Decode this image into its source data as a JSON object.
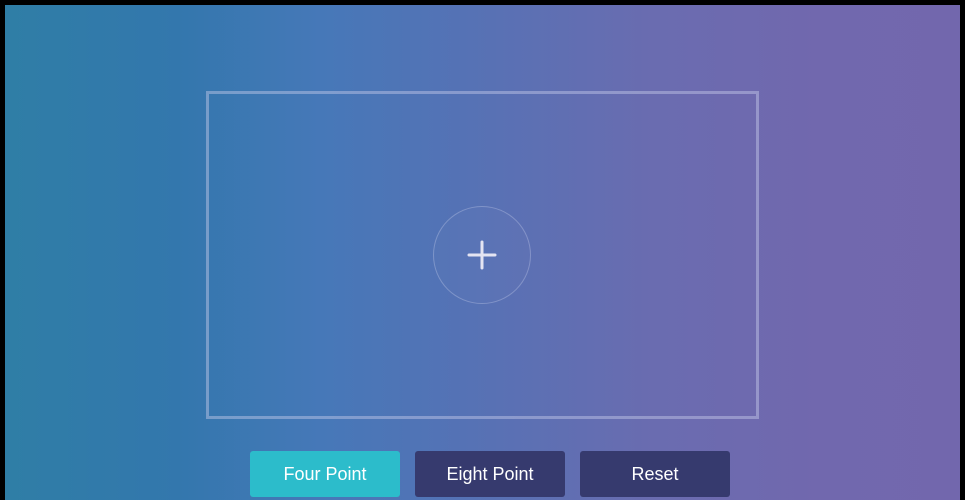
{
  "screen": {
    "gradient_colors": [
      "#2f7ea6",
      "#4678b8",
      "#7267ad"
    ],
    "frame_color": "#c8cdeb"
  },
  "center": {
    "icon": "plus-icon"
  },
  "buttons": {
    "four_point": {
      "label": "Four Point",
      "color": "#2cbccb",
      "selected": true
    },
    "eight_point": {
      "label": "Eight Point",
      "color": "#363a6e",
      "selected": false
    },
    "reset": {
      "label": "Reset",
      "color": "#363a6e"
    }
  }
}
